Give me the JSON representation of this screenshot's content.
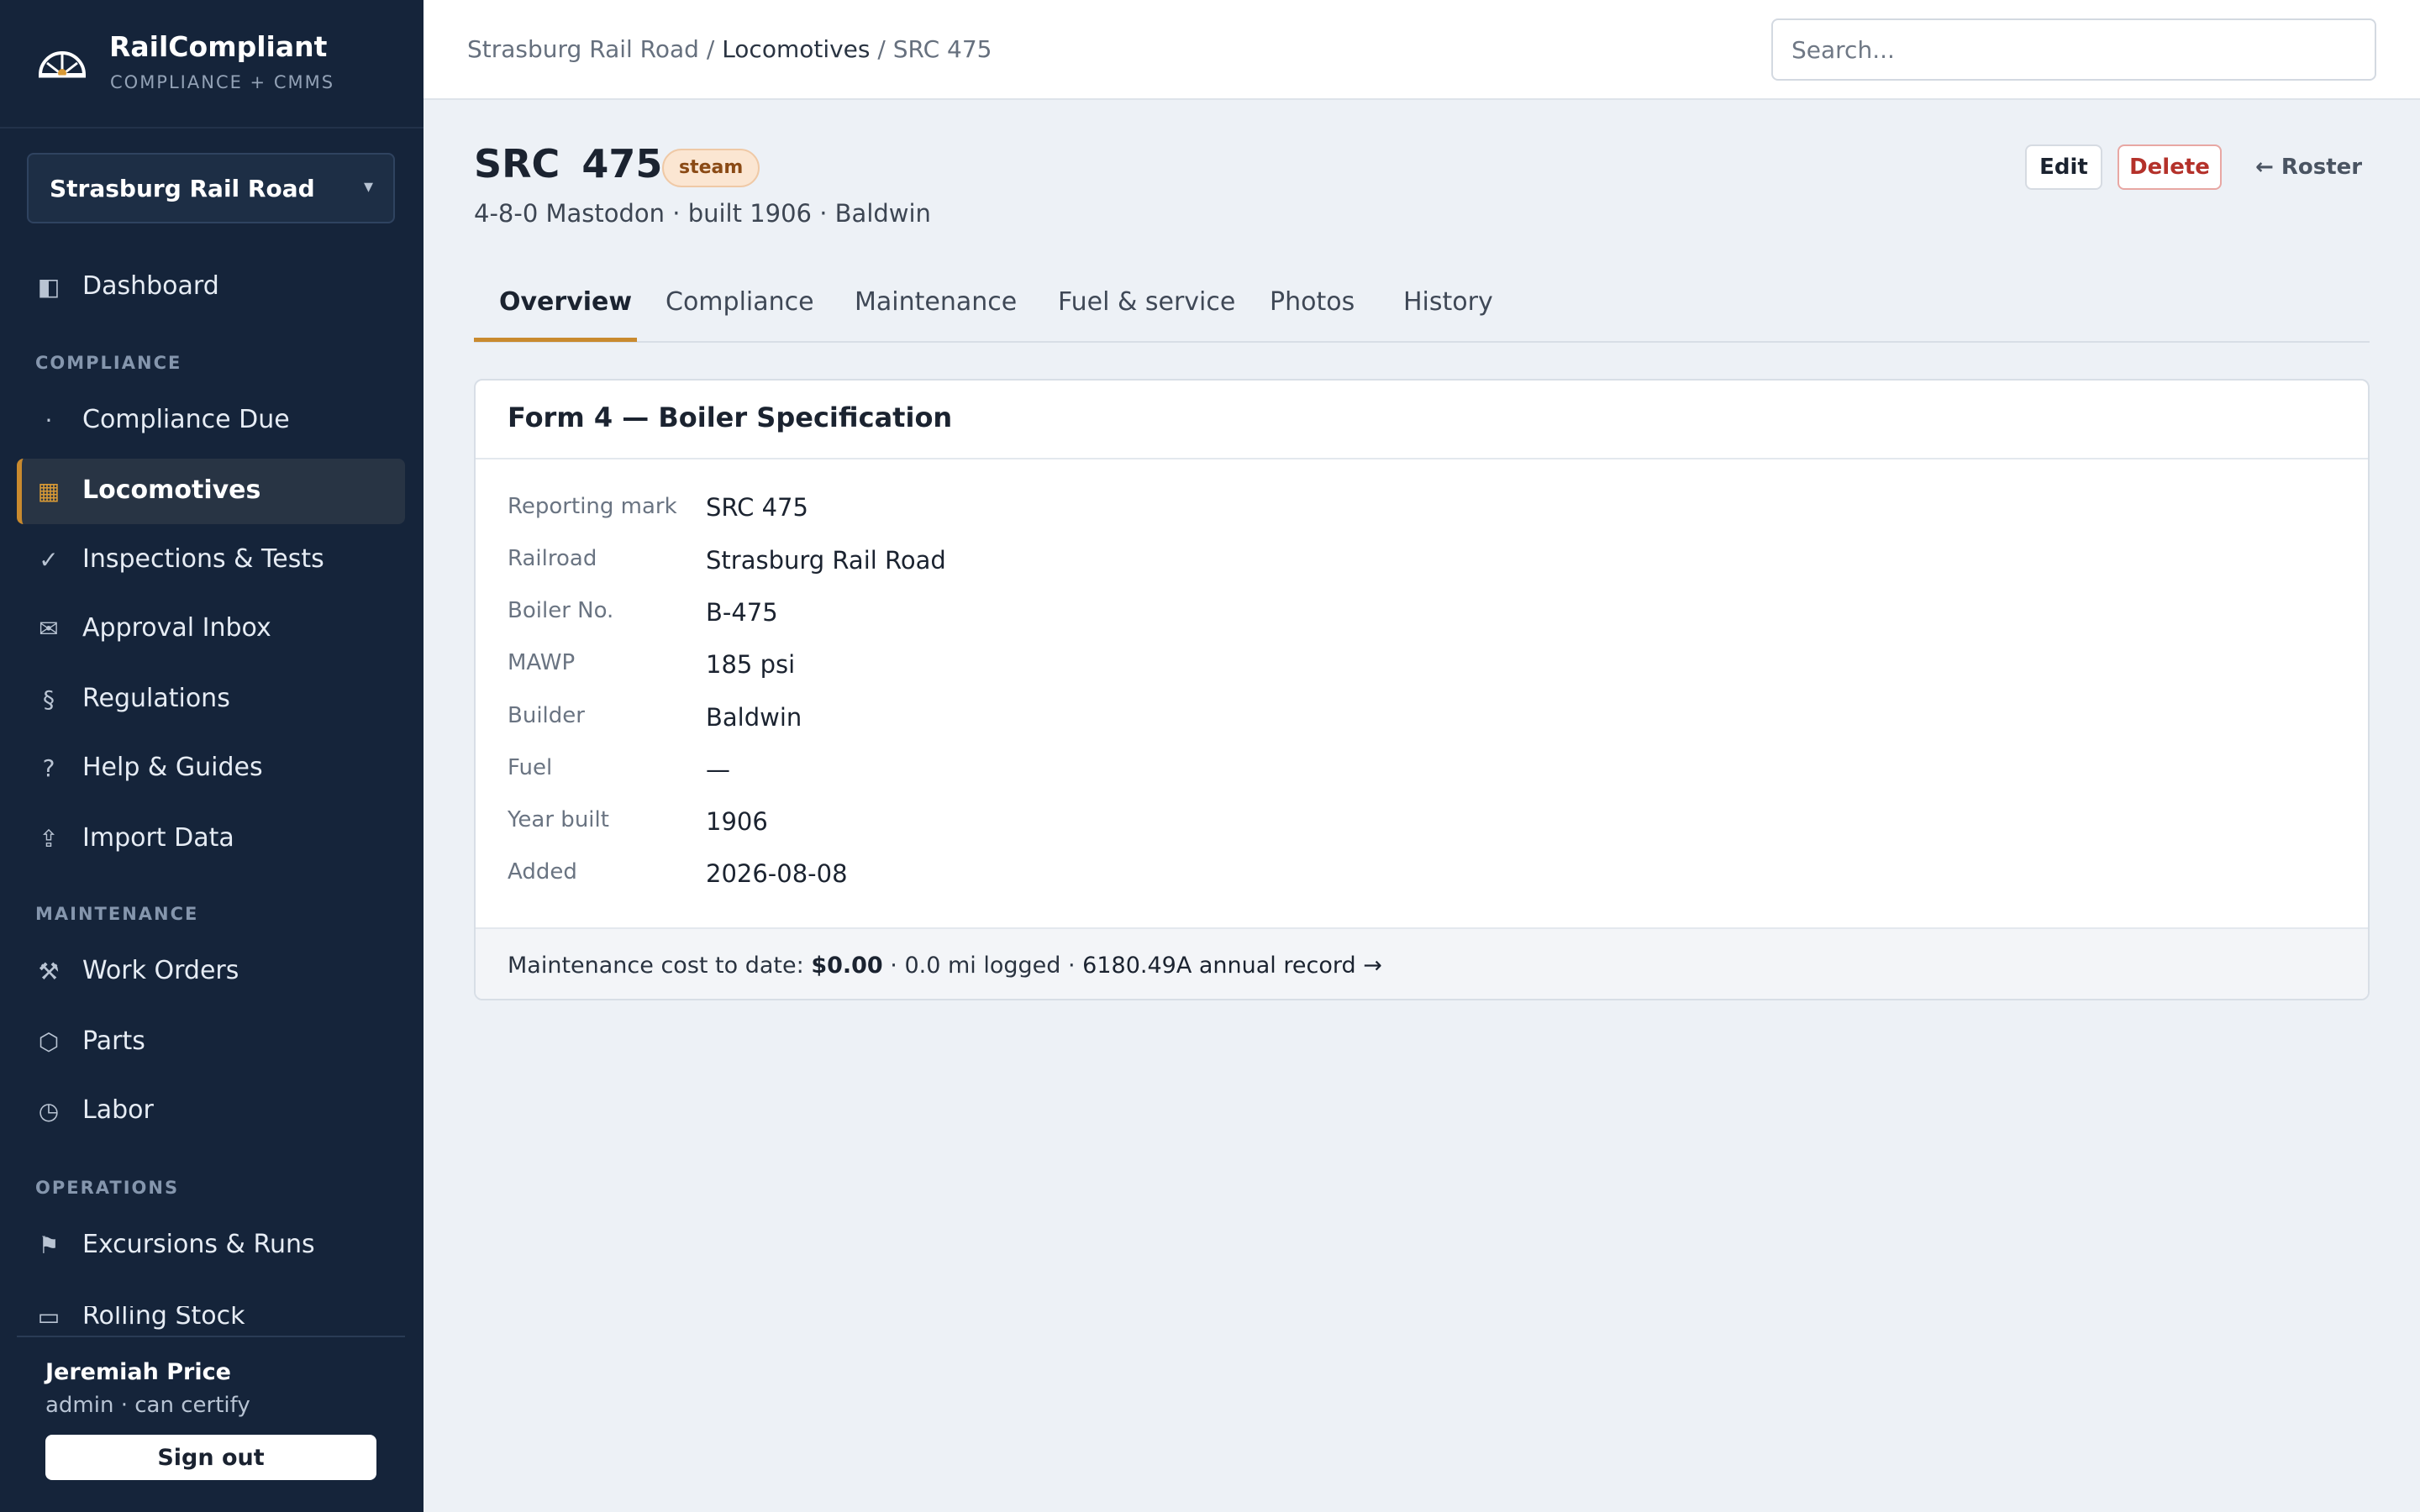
{
  "brand": {
    "name": "RailCompliant",
    "subtitle": "COMPLIANCE + CMMS",
    "logo_icon": "half-wheel-logo"
  },
  "railroad_selector": {
    "selected": "Strasburg Rail Road",
    "caret": "▾"
  },
  "sidebar": {
    "top_items": [
      {
        "label": "Dashboard",
        "icon": "◧",
        "icon_name": "dashboard-icon"
      }
    ],
    "sections": [
      {
        "title": "COMPLIANCE",
        "items": [
          {
            "label": "Compliance Due",
            "icon": "·",
            "icon_name": "dot-icon"
          },
          {
            "label": "Locomotives",
            "icon": "▦",
            "icon_name": "grid-icon",
            "active": true
          },
          {
            "label": "Inspections & Tests",
            "icon": "✓",
            "icon_name": "check-icon"
          },
          {
            "label": "Approval Inbox",
            "icon": "✉",
            "icon_name": "envelope-icon"
          },
          {
            "label": "Regulations",
            "icon": "§",
            "icon_name": "section-icon"
          },
          {
            "label": "Help & Guides",
            "icon": "?",
            "icon_name": "help-icon"
          },
          {
            "label": "Import Data",
            "icon": "⇪",
            "icon_name": "upload-icon"
          }
        ]
      },
      {
        "title": "MAINTENANCE",
        "items": [
          {
            "label": "Work Orders",
            "icon": "⚒",
            "icon_name": "tools-icon"
          },
          {
            "label": "Parts",
            "icon": "⬡",
            "icon_name": "hexagon-icon"
          },
          {
            "label": "Labor",
            "icon": "◷",
            "icon_name": "clock-icon"
          }
        ]
      },
      {
        "title": "OPERATIONS",
        "items": [
          {
            "label": "Excursions & Runs",
            "icon": "⚑",
            "icon_name": "flag-icon"
          },
          {
            "label": "Rolling Stock",
            "icon": "▭",
            "icon_name": "railcar-icon"
          }
        ]
      }
    ]
  },
  "user": {
    "name": "Jeremiah Price",
    "role": "admin · can certify",
    "signout_label": "Sign out"
  },
  "breadcrumb": {
    "railroad": "Strasburg Rail Road",
    "sep1": " / ",
    "section": "Locomotives",
    "sep2": " / ",
    "current": "SRC 475"
  },
  "search": {
    "placeholder": "Search..."
  },
  "locomotive": {
    "title": "SRC  475",
    "type_badge": "steam",
    "subtitle": "4-8-0 Mastodon · built 1906 · Baldwin"
  },
  "actions": {
    "edit": "Edit",
    "delete": "Delete",
    "roster": "← Roster"
  },
  "tabs": [
    "Overview",
    "Compliance",
    "Maintenance",
    "Fuel & service",
    "Photos",
    "History"
  ],
  "active_tab": "Overview",
  "card": {
    "title": "Form 4 — Boiler Specification",
    "fields": [
      {
        "label": "Reporting mark",
        "value": "SRC 475"
      },
      {
        "label": "Railroad",
        "value": "Strasburg Rail Road"
      },
      {
        "label": "Boiler No.",
        "value": "B-475"
      },
      {
        "label": "MAWP",
        "value": "185 psi"
      },
      {
        "label": "Builder",
        "value": "Baldwin"
      },
      {
        "label": "Fuel",
        "value": "—"
      },
      {
        "label": "Year built",
        "value": "1906"
      },
      {
        "label": "Added",
        "value": "2026-08-08"
      }
    ],
    "footer": {
      "cost_prefix": "Maintenance cost to date: ",
      "cost": "$0.00",
      "mileage": " · 0.0 mi logged · ",
      "record_link": "6180.49A annual record →"
    }
  },
  "colors": {
    "sidebar_bg": "#15243a",
    "accent": "#c98a2e",
    "delete": "#b4312a",
    "page_bg": "#edf1f6"
  }
}
